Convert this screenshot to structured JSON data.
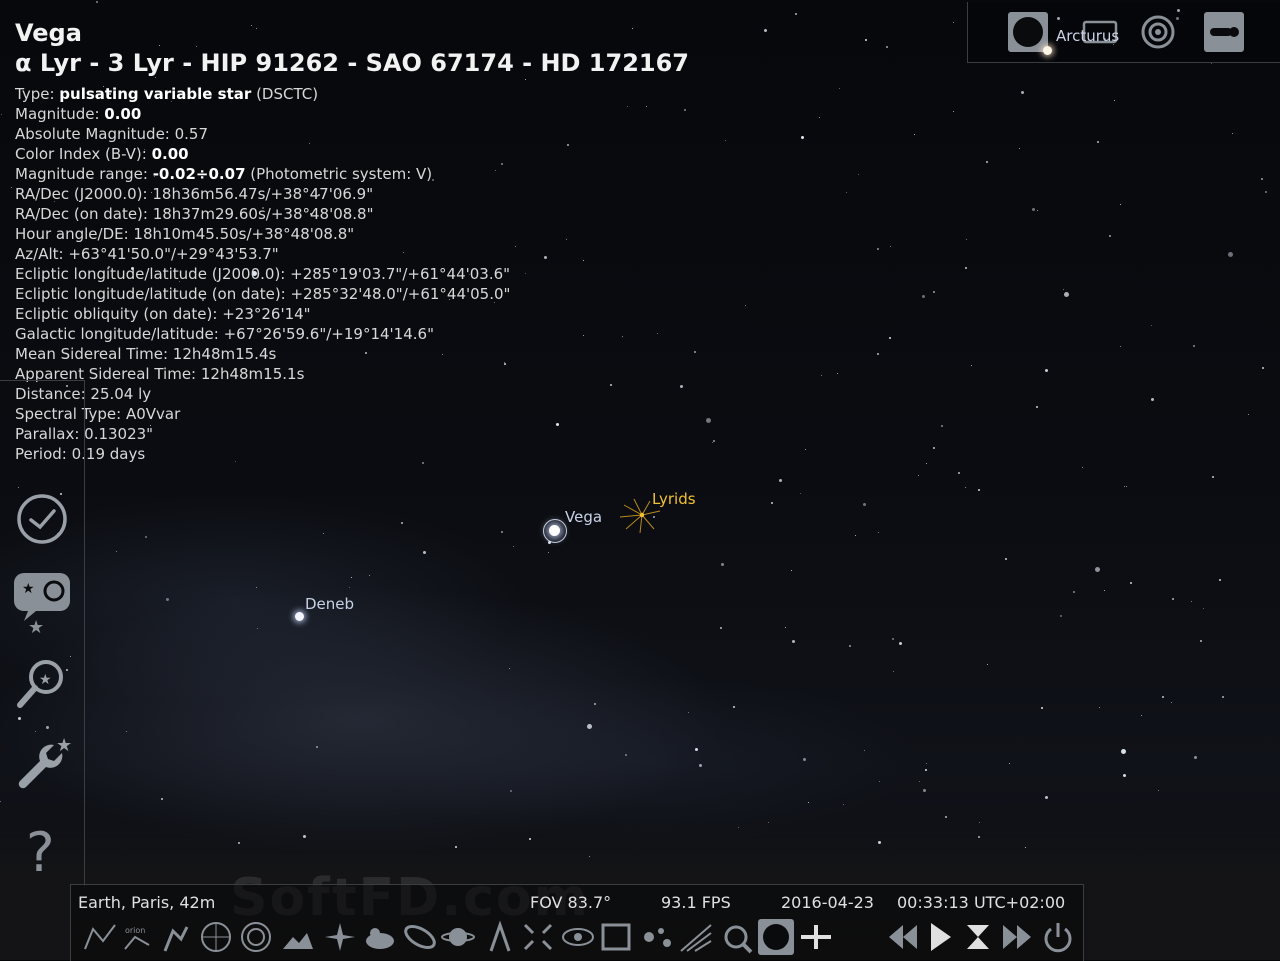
{
  "object": {
    "name": "Vega",
    "identifiers": "α Lyr - 3 Lyr - HIP 91262 - SAO 67174 - HD 172167",
    "type_label": "Type: ",
    "type_value": "pulsating variable star",
    "type_code": " (DSCTC)",
    "magnitude_label": "Magnitude: ",
    "magnitude_value": "0.00",
    "absolute_magnitude": "Absolute Magnitude: 0.57",
    "color_index_label": "Color Index (B-V): ",
    "color_index_value": "0.00",
    "magnitude_range_label": "Magnitude range: ",
    "magnitude_range_value": "-0.02÷0.07",
    "magnitude_range_system": " (Photometric system: V)",
    "ra_dec_j2000": "RA/Dec (J2000.0): 18h36m56.47s/+38°47'06.9\"",
    "ra_dec_date": "RA/Dec (on date): 18h37m29.60s/+38°48'08.8\"",
    "hour_angle": "Hour angle/DE: 18h10m45.50s/+38°48'08.8\"",
    "az_alt": "Az/Alt: +63°41'50.0\"/+29°43'53.7\"",
    "ecliptic_j2000": "Ecliptic longitude/latitude (J2000.0): +285°19'03.7\"/+61°44'03.6\"",
    "ecliptic_date": "Ecliptic longitude/latitude (on date): +285°32'48.0\"/+61°44'05.0\"",
    "ecliptic_obliquity": "Ecliptic obliquity (on date): +23°26'14\"",
    "galactic": "Galactic longitude/latitude: +67°26'59.6\"/+19°14'14.6\"",
    "mean_sidereal": "Mean Sidereal Time: 12h48m15.4s",
    "apparent_sidereal": "Apparent Sidereal Time: 12h48m15.1s",
    "distance": "Distance: 25.04 ly",
    "spectral_type": "Spectral Type: A0Vvar",
    "parallax": "Parallax: 0.13023\"",
    "period": "Period: 0.19 days"
  },
  "sky_labels": {
    "vega": "Vega",
    "lyrids": "Lyrids",
    "deneb": "Deneb",
    "arcturus": "Arcturus"
  },
  "status_bar": {
    "location": "Earth, Paris, 42m",
    "fov": "FOV 83.7°",
    "fps": "93.1 FPS",
    "date": "2016-04-23",
    "time": "00:33:13 UTC+02:00"
  },
  "watermark": "SoftFD.com",
  "left_bar": [
    "clock-icon",
    "sky-and-viewing-options-icon",
    "search-icon",
    "configuration-icon",
    "help-icon"
  ],
  "bottom_bar_icons": [
    "constellation-lines-icon",
    "constellation-labels-icon",
    "constellation-art-icon",
    "equatorial-grid-icon",
    "azimuthal-grid-icon",
    "ground-icon",
    "cardinal-points-icon",
    "atmosphere-icon",
    "deep-sky-objects-icon",
    "planet-labels-icon",
    "mount-mode-icon",
    "center-on-object-icon",
    "night-mode-icon",
    "full-screen-icon",
    "exoplanets-icon",
    "meteor-showers-icon",
    "satellites-icon",
    "ocular-icon",
    "telescope-icon",
    "rewind-icon",
    "play-icon",
    "set-time-now-icon",
    "fast-forward-icon",
    "quit-icon"
  ],
  "colors": {
    "label_blue": "#c8d2e6",
    "label_yellow": "#f1c232",
    "accent_panel_border": "#3a3d42"
  }
}
